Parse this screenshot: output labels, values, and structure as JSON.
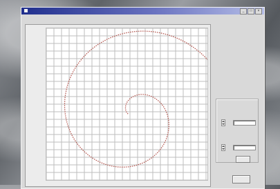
{
  "window": {
    "title": ""
  },
  "menu": {
    "file": "",
    "help": ""
  },
  "plot": {
    "y_labels": [
      "",
      "",
      "",
      "",
      "",
      "",
      "",
      "",
      "",
      "",
      "",
      "",
      "",
      "",
      "",
      "",
      "",
      "",
      "",
      "",
      ""
    ],
    "x_labels": [
      "",
      "",
      "",
      "",
      "",
      "",
      "",
      "",
      ""
    ],
    "curve_color": "#b4574f"
  },
  "side_panel": {
    "text_top": "",
    "text_bottom": "",
    "group_title": "",
    "field_1_label": "",
    "field_1_value": "",
    "field_2_label": "",
    "field_2_value": "",
    "apply_button": "",
    "bottom_button": ""
  }
}
